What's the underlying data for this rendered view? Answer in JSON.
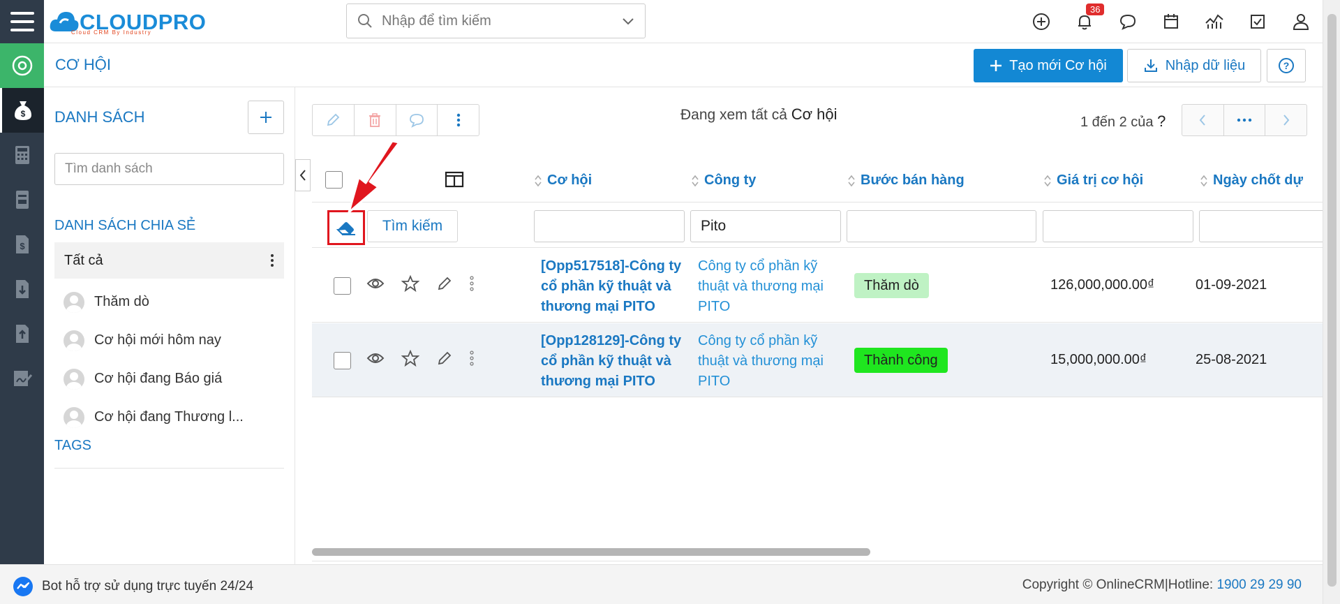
{
  "app": {
    "logo_text": "CLOUDPRO",
    "logo_tagline": "Cloud CRM By Industry",
    "search_placeholder": "Nhập để tìm kiếm",
    "notification_count": "36"
  },
  "header": {
    "module_title": "CƠ HỘI",
    "create_button": "Tạo mới Cơ hội",
    "import_button": "Nhập dữ liệu"
  },
  "left_panel": {
    "title": "DANH SÁCH",
    "search_placeholder": "Tìm danh sách",
    "shared_title": "DANH SÁCH CHIA SẺ",
    "all_item": "Tất cả",
    "items": [
      {
        "label": "Thăm dò"
      },
      {
        "label": "Cơ hội mới hôm nay"
      },
      {
        "label": "Cơ hội đang Báo giá"
      },
      {
        "label": "Cơ hội đang Thương l..."
      }
    ],
    "tags_title": "TAGS"
  },
  "main": {
    "viewing_prefix": "Đang xem tất cả",
    "viewing_module": "Cơ hội",
    "pagination_text": "1 đến 2 của",
    "pagination_unknown": "?",
    "search_button": "Tìm kiếm",
    "columns": [
      {
        "label": "Cơ hội"
      },
      {
        "label": "Công ty"
      },
      {
        "label": "Bước bán hàng"
      },
      {
        "label": "Giá trị cơ hội"
      },
      {
        "label": "Ngày chốt dự"
      }
    ],
    "filters": {
      "opportunity": "",
      "company": "Pito",
      "stage": "",
      "value": "",
      "date": ""
    },
    "rows": [
      {
        "opportunity": "[Opp517518]-Công ty cổ phần kỹ thuật và thương mại PITO",
        "company": "Công ty cổ phần kỹ thuật và thương mại PITO",
        "stage": "Thăm dò",
        "stage_color": "#bff2c4",
        "value": "126,000,000.00₫",
        "date": "01-09-2021"
      },
      {
        "opportunity": "[Opp128129]-Công ty cổ phần kỹ thuật và thương mại PITO",
        "company": "Công ty cổ phần kỹ thuật và thương mại PITO",
        "stage": "Thành công",
        "stage_color": "#1fe61f",
        "value": "15,000,000.00₫",
        "date": "25-08-2021"
      }
    ]
  },
  "footer": {
    "bot_text": "Bot hỗ trợ sử dụng trực tuyến 24/24",
    "copyright": "Copyright © OnlineCRM",
    "separator": "|",
    "hotline_label": "Hotline:",
    "hotline": "1900 29 29 90"
  },
  "colors": {
    "accent": "#1a78c2",
    "primary_button": "#1388d4",
    "rail": "#2f3b49",
    "rail_active_green": "#3cb56a",
    "highlight_red": "#e0161e"
  }
}
